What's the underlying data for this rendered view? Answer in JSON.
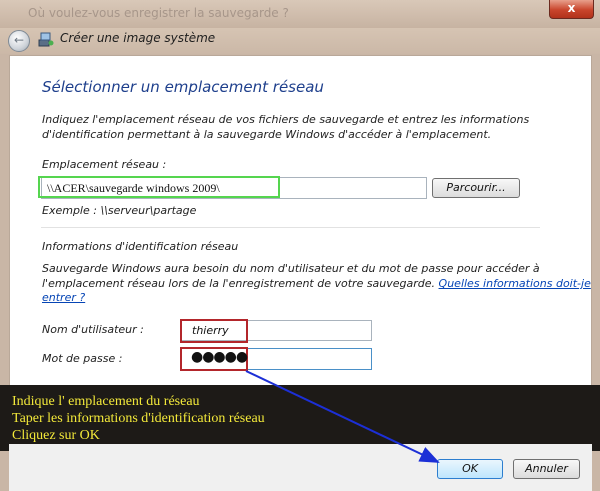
{
  "window": {
    "ghost_title": "Où voulez-vous enregistrer la sauvegarde ?",
    "close_label": "x"
  },
  "nav": {
    "title": "Créer une image système",
    "back_icon": "back-arrow-icon"
  },
  "main": {
    "heading": "Sélectionner un emplacement réseau",
    "intro_line1": "Indiquez l'emplacement réseau de vos fichiers de sauvegarde et entrez les informations",
    "intro_line2": "d'identification permettant à la sauvegarde Windows d'accéder à l'emplacement.",
    "location_label": "Emplacement réseau :",
    "location_value": "\\\\ACER\\sauvegarde windows 2009\\",
    "browse_label": "Parcourir...",
    "example": "Exemple : \\\\serveur\\partage",
    "credentials_heading": "Informations d'identification réseau",
    "cred_line1": "Sauvegarde Windows aura besoin du nom d'utilisateur et du mot de passe pour accéder à",
    "cred_line2": "l'emplacement réseau lors de la l'enregistrement de votre sauvegarde.",
    "cred_link_part1": "Quelles informations doit-je",
    "cred_link_part2": "entrer ?",
    "username_label": "Nom d'utilisateur :",
    "username_value": "thierry",
    "password_label": "Mot de passe :",
    "password_value": "●●●●●"
  },
  "overlay": {
    "line1": "Indique l' emplacement du réseau",
    "line2": "Taper les informations d'identification réseau",
    "line3": "Cliquez sur OK"
  },
  "footer": {
    "ok_label": "OK",
    "cancel_label": "Annuler"
  },
  "colors": {
    "heading": "#1e3f8c",
    "link": "#0645b5",
    "highlight_green": "#55d54f",
    "highlight_red": "#b3262b",
    "overlay_text": "#f3e93a",
    "arrow": "#1c2fd6"
  }
}
